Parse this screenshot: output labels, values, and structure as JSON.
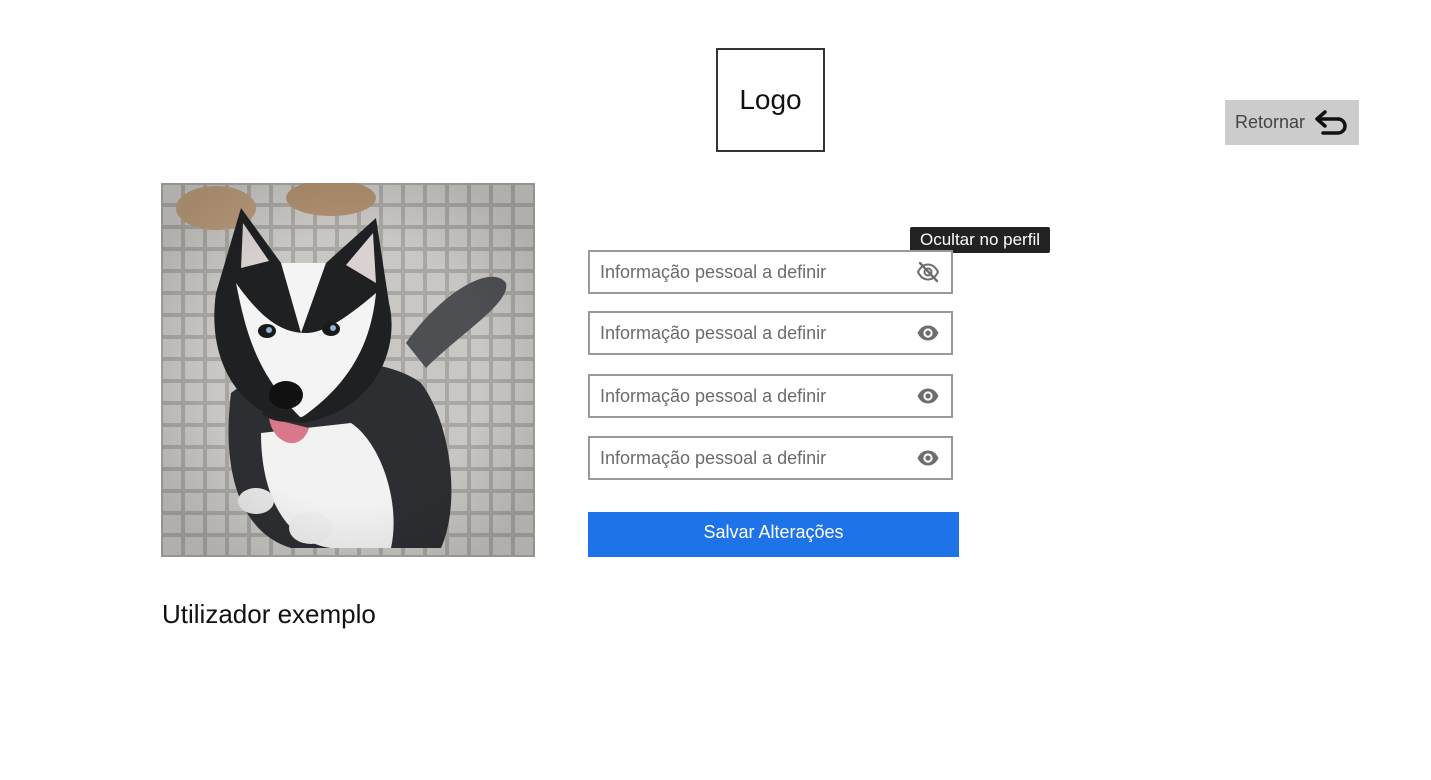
{
  "header": {
    "logo_text": "Logo",
    "return_label": "Retornar"
  },
  "profile": {
    "username": "Utilizador exemplo",
    "avatar_alt": "dog photo"
  },
  "fields": [
    {
      "placeholder": "Informação pessoal a definir",
      "visibility_icon": "eye-off-icon"
    },
    {
      "placeholder": "Informação pessoal a definir",
      "visibility_icon": "eye-icon"
    },
    {
      "placeholder": "Informação pessoal a definir",
      "visibility_icon": "eye-icon"
    },
    {
      "placeholder": "Informação pessoal a definir",
      "visibility_icon": "eye-icon"
    }
  ],
  "tooltip": {
    "text": "Ocultar no perfil"
  },
  "actions": {
    "save_label": "Salvar Alterações"
  },
  "colors": {
    "primary": "#1e73e8",
    "return_bg": "#cccccc",
    "tooltip_bg": "#222222"
  }
}
